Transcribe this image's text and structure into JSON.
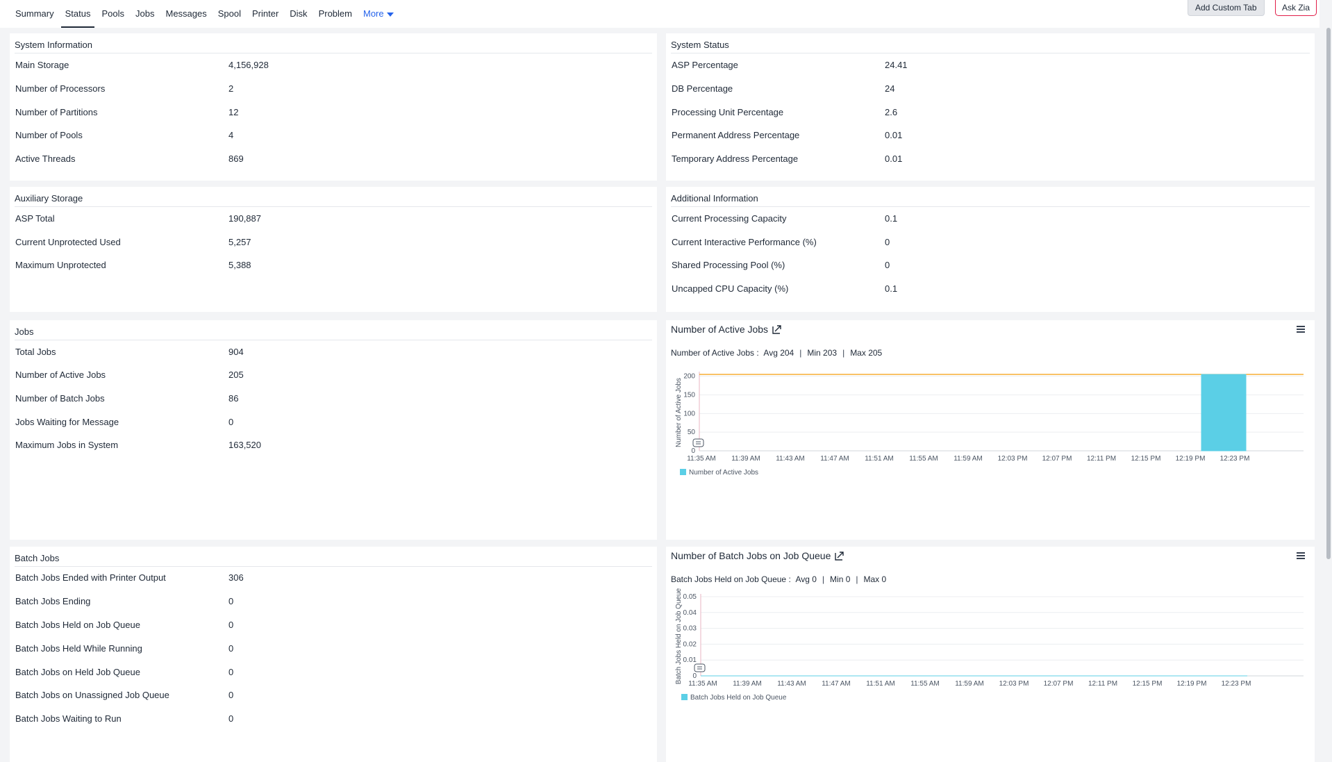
{
  "tabs": [
    "Summary",
    "Status",
    "Pools",
    "Jobs",
    "Messages",
    "Spool",
    "Printer",
    "Disk",
    "Problem"
  ],
  "more_label": "More",
  "buttons": {
    "add_custom_tab": "Add Custom Tab",
    "ask_zia": "Ask Zia"
  },
  "system_information": {
    "title": "System Information",
    "rows": [
      {
        "label": "Main Storage",
        "value": "4,156,928"
      },
      {
        "label": "Number of Processors",
        "value": "2"
      },
      {
        "label": "Number of Partitions",
        "value": "12"
      },
      {
        "label": "Number of Pools",
        "value": "4"
      },
      {
        "label": "Active Threads",
        "value": "869"
      }
    ]
  },
  "system_status": {
    "title": "System Status",
    "rows": [
      {
        "label": "ASP Percentage",
        "value": "24.41"
      },
      {
        "label": "DB Percentage",
        "value": "24"
      },
      {
        "label": "Processing Unit Percentage",
        "value": "2.6"
      },
      {
        "label": "Permanent Address Percentage",
        "value": "0.01"
      },
      {
        "label": "Temporary Address Percentage",
        "value": "0.01"
      }
    ]
  },
  "auxiliary_storage": {
    "title": "Auxiliary Storage",
    "rows": [
      {
        "label": "ASP Total",
        "value": "190,887"
      },
      {
        "label": "Current Unprotected Used",
        "value": "5,257"
      },
      {
        "label": "Maximum Unprotected",
        "value": "5,388"
      }
    ]
  },
  "additional_information": {
    "title": "Additional Information",
    "rows": [
      {
        "label": "Current Processing Capacity",
        "value": "0.1"
      },
      {
        "label": "Current Interactive Performance (%)",
        "value": "0"
      },
      {
        "label": "Shared Processing Pool (%)",
        "value": "0"
      },
      {
        "label": "Uncapped CPU Capacity (%)",
        "value": "0.1"
      }
    ]
  },
  "jobs": {
    "title": "Jobs",
    "rows": [
      {
        "label": "Total Jobs",
        "value": "904"
      },
      {
        "label": "Number of Active Jobs",
        "value": "205"
      },
      {
        "label": "Number of Batch Jobs",
        "value": "86"
      },
      {
        "label": "Jobs Waiting for Message",
        "value": "0"
      },
      {
        "label": "Maximum Jobs in System",
        "value": "163,520"
      }
    ]
  },
  "batch_jobs": {
    "title": "Batch Jobs",
    "rows": [
      {
        "label": "Batch Jobs Ended with Printer Output",
        "value": "306"
      },
      {
        "label": "Batch Jobs Ending",
        "value": "0"
      },
      {
        "label": "Batch Jobs Held on Job Queue",
        "value": "0"
      },
      {
        "label": "Batch Jobs Held While Running",
        "value": "0"
      },
      {
        "label": "Batch Jobs on Held Job Queue",
        "value": "0"
      },
      {
        "label": "Batch Jobs on Unassigned Job Queue",
        "value": "0"
      },
      {
        "label": "Batch Jobs Waiting to Run",
        "value": "0"
      }
    ]
  },
  "active_jobs_panel": {
    "title": "Number of Active Jobs",
    "stats_label": "Number of Active Jobs :",
    "avg": "Avg 204",
    "min": "Min 203",
    "max": "Max 205"
  },
  "batch_queue_panel": {
    "title": "Number of Batch Jobs on Job Queue",
    "stats_label": "Batch Jobs Held on Job Queue :",
    "avg": "Avg 0",
    "min": "Min 0",
    "max": "Max 0"
  },
  "chart_data": [
    {
      "type": "area",
      "ylabel": "Number of Active Jobs",
      "xlabel": "",
      "categories": [
        "11:35 AM",
        "11:39 AM",
        "11:43 AM",
        "11:47 AM",
        "11:51 AM",
        "11:55 AM",
        "11:59 AM",
        "12:03 PM",
        "12:07 PM",
        "12:11 PM",
        "12:15 PM",
        "12:19 PM",
        "12:23 PM"
      ],
      "yticks": [
        0,
        50,
        100,
        150,
        200
      ],
      "ylim": [
        0,
        205
      ],
      "threshold_line": 205,
      "series": [
        {
          "name": "Number of Active Jobs",
          "color": "#5bcfe6",
          "points": [
            {
              "x": "12:20 PM",
              "y": 205
            },
            {
              "x": "12:24 PM",
              "y": 205
            }
          ]
        }
      ],
      "grid": true,
      "legend": "bottom-left"
    },
    {
      "type": "area",
      "ylabel": "Batch Jobs Held on Job Queue",
      "xlabel": "",
      "categories": [
        "11:35 AM",
        "11:39 AM",
        "11:43 AM",
        "11:47 AM",
        "11:51 AM",
        "11:55 AM",
        "11:59 AM",
        "12:03 PM",
        "12:07 PM",
        "12:11 PM",
        "12:15 PM",
        "12:19 PM",
        "12:23 PM"
      ],
      "yticks": [
        0,
        0.01,
        0.02,
        0.03,
        0.04,
        0.05
      ],
      "ylim": [
        0,
        0.05
      ],
      "series": [
        {
          "name": "Batch Jobs Held on Job Queue",
          "color": "#5bcfe6",
          "points": [
            {
              "x": "11:32 AM",
              "y": 0
            },
            {
              "x": "12:24 PM",
              "y": 0
            }
          ]
        }
      ],
      "grid": true,
      "legend": "bottom-left"
    }
  ],
  "colors": {
    "accent": "#2563eb",
    "series": "#5bcfe6",
    "threshold": "#f59e0b",
    "zia_border": "#e11d48"
  }
}
